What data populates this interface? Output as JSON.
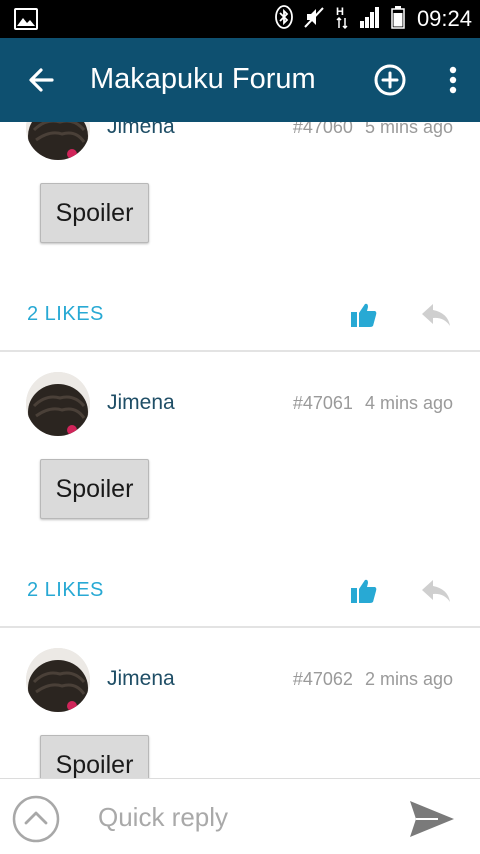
{
  "status_bar": {
    "time": "09:24",
    "icons": [
      "gallery-icon",
      "bluetooth-icon",
      "mute-icon",
      "network-h-icon",
      "signal-icon",
      "battery-icon"
    ]
  },
  "app_bar": {
    "title": "Makapuku Forum",
    "icons": [
      "back-arrow-icon",
      "add-circle-icon",
      "more-vert-icon"
    ]
  },
  "posts": [
    {
      "author": "Jimena",
      "number": "#47060",
      "time": "5 mins ago",
      "button": "Spoiler",
      "likes": "2 LIKES"
    },
    {
      "author": "Jimena",
      "number": "#47061",
      "time": "4 mins ago",
      "button": "Spoiler",
      "likes": "2 LIKES"
    },
    {
      "author": "Jimena",
      "number": "#47062",
      "time": "2 mins ago",
      "button": "Spoiler"
    }
  ],
  "quick_reply": {
    "placeholder": "Quick reply",
    "icons": [
      "expand-up-icon",
      "send-icon"
    ]
  },
  "colors": {
    "app_bar": "#0e5070",
    "likes_accent": "#28a9d4",
    "author": "#1f4e66",
    "meta": "#9a9a9a"
  }
}
